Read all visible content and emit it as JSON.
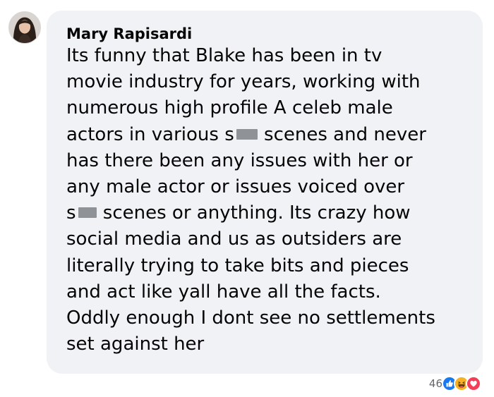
{
  "comment": {
    "author": "Mary Rapisardi",
    "lines": [
      {
        "before": "Its funny that Blake has been in tv",
        "redacted": false,
        "after": ""
      },
      {
        "before": "movie industry for years, working with",
        "redacted": false,
        "after": ""
      },
      {
        "before": "numerous high profile A celeb male",
        "redacted": false,
        "after": ""
      },
      {
        "before": "actors in various s",
        "redacted": true,
        "after": " scenes and never"
      },
      {
        "before": "has there been any issues with her or",
        "redacted": false,
        "after": ""
      },
      {
        "before": "any male actor or issues voiced over",
        "redacted": false,
        "after": ""
      },
      {
        "before": "s",
        "redacted": true,
        "after": " scenes or anything. Its crazy how"
      },
      {
        "before": "social media and us as outsiders are",
        "redacted": false,
        "after": ""
      },
      {
        "before": "literally trying to take bits and pieces",
        "redacted": false,
        "after": ""
      },
      {
        "before": "and act like yall have all the facts.",
        "redacted": false,
        "after": ""
      },
      {
        "before": "Oddly enough I dont see no settlements",
        "redacted": false,
        "after": ""
      },
      {
        "before": "set against her",
        "redacted": false,
        "after": ""
      }
    ]
  },
  "reactions": {
    "count": "46",
    "types": [
      "like",
      "haha",
      "love"
    ]
  },
  "colors": {
    "bubble": "#f0f2f5",
    "text": "#050505",
    "meta": "#65676b",
    "like": "#1877f2",
    "love": "#f33e58",
    "haha": "#f7b125",
    "redaction": "#8f9296"
  }
}
